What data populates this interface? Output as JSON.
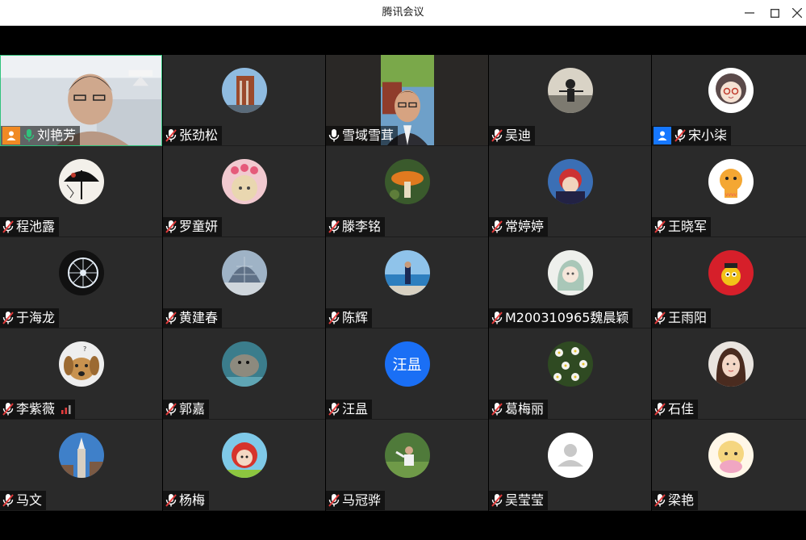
{
  "window": {
    "title": "腾讯会议"
  },
  "colors": {
    "tile_bg": "#2a2a2a",
    "active_border": "#31c27c",
    "host_badge": "#f08a24",
    "cohost_badge": "#1677ff",
    "text_avatar": "#1a6ff5",
    "mic_on": "#31c27c",
    "mic_muted": "#ffffff"
  },
  "participants": [
    {
      "name": "刘艳芳",
      "mic": "on-green",
      "role": "host",
      "view": "video",
      "active_speaker": true
    },
    {
      "name": "张劲松",
      "mic": "muted",
      "view": "avatar",
      "avatar": "brick-building-photo"
    },
    {
      "name": "雪域雪茸",
      "mic": "on",
      "view": "video"
    },
    {
      "name": "吴迪",
      "mic": "muted",
      "view": "avatar",
      "avatar": "beach-person-photo"
    },
    {
      "name": "宋小柒",
      "mic": "muted",
      "role": "cohost",
      "view": "avatar",
      "avatar": "cartoon-girl"
    },
    {
      "name": "程池露",
      "mic": "muted",
      "view": "avatar",
      "avatar": "umbrella-painting"
    },
    {
      "name": "罗童妍",
      "mic": "muted",
      "view": "avatar",
      "avatar": "anime-girl-hearts"
    },
    {
      "name": "滕李铭",
      "mic": "muted",
      "view": "avatar",
      "avatar": "mushroom-photo"
    },
    {
      "name": "常婷婷",
      "mic": "muted",
      "view": "avatar",
      "avatar": "child-helmet-photo"
    },
    {
      "name": "王晓军",
      "mic": "muted",
      "view": "avatar",
      "avatar": "tiger-cartoon"
    },
    {
      "name": "于海龙",
      "mic": "muted",
      "view": "avatar",
      "avatar": "wheel-photo"
    },
    {
      "name": "黄建春",
      "mic": "muted",
      "view": "avatar",
      "avatar": "glass-dome-photo"
    },
    {
      "name": "陈辉",
      "mic": "muted",
      "view": "avatar",
      "avatar": "seaside-person-photo"
    },
    {
      "name": "M200310965魏晨颖",
      "mic": "muted",
      "view": "avatar",
      "avatar": "sketch-girl"
    },
    {
      "name": "王雨阳",
      "mic": "muted",
      "view": "avatar",
      "avatar": "red-cartoon"
    },
    {
      "name": "李紫薇",
      "mic": "muted",
      "view": "avatar",
      "avatar": "dog-photo",
      "signal": true
    },
    {
      "name": "郭嘉",
      "mic": "muted",
      "view": "avatar",
      "avatar": "seal-photo"
    },
    {
      "name": "汪昷",
      "mic": "muted",
      "view": "avatar",
      "avatar_text": "汪昷"
    },
    {
      "name": "葛梅丽",
      "mic": "muted",
      "view": "avatar",
      "avatar": "flowers-photo"
    },
    {
      "name": "石佳",
      "mic": "muted",
      "view": "avatar",
      "avatar": "woman-portrait"
    },
    {
      "name": "马文",
      "mic": "muted",
      "view": "avatar",
      "avatar": "tower-photo"
    },
    {
      "name": "杨梅",
      "mic": "muted",
      "view": "avatar",
      "avatar": "red-hood-cartoon"
    },
    {
      "name": "马冠骅",
      "mic": "muted",
      "view": "avatar",
      "avatar": "child-grass-photo"
    },
    {
      "name": "吴莹莹",
      "mic": "muted",
      "view": "avatar",
      "avatar": "default-user"
    },
    {
      "name": "梁艳",
      "mic": "muted",
      "view": "avatar",
      "avatar": "yellow-cartoon"
    }
  ]
}
